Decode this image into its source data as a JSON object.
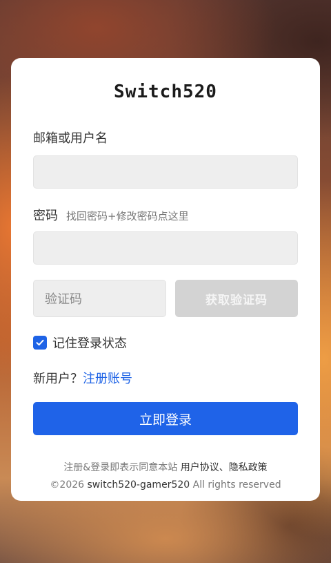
{
  "brand": {
    "name": "Switch520"
  },
  "form": {
    "username_label": "邮箱或用户名",
    "username_value": "",
    "password_label": "密码",
    "forgot_link": "找回密码+修改密码点这里",
    "password_value": "",
    "captcha_placeholder": "验证码",
    "get_code_label": "获取验证码",
    "remember_label": "记住登录状态",
    "remember_checked": true,
    "new_user_text": "新用户？",
    "register_link": "注册账号",
    "login_button": "立即登录"
  },
  "footer": {
    "terms_prefix": "注册&登录即表示同意本站",
    "user_agreement": "用户协议",
    "separator": "、",
    "privacy_policy": "隐私政策",
    "copyright_prefix": "©2026",
    "site_name": "switch520-gamer520",
    "rights": "All rights reserved"
  },
  "colors": {
    "accent": "#1f63e8",
    "checkbox": "#1e63e6",
    "disabled_button": "#d3d3d3",
    "input_bg": "#eeeeee"
  }
}
